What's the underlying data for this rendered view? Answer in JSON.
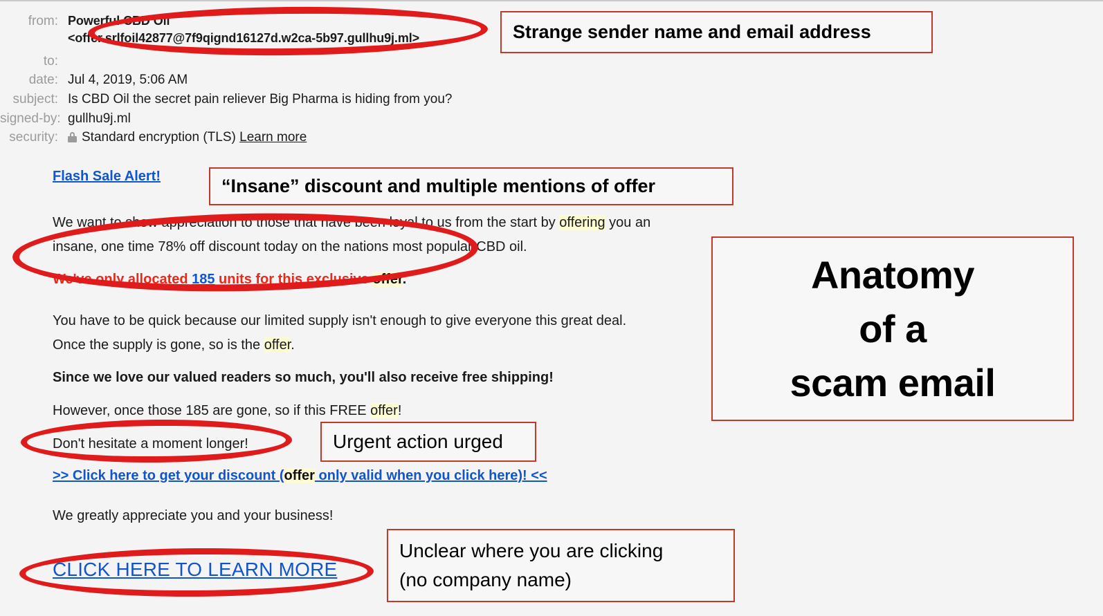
{
  "email_header": {
    "rows": [
      {
        "label": "from:",
        "value_name": "Powerful CBD Oil",
        "value_address": "<offer.srlfoil42877@7f9qignd16127d.w2ca-5b97.gullhu9j.ml>"
      },
      {
        "label": "to:",
        "value": ""
      },
      {
        "label": "date:",
        "value": "Jul 4, 2019, 5:06 AM"
      },
      {
        "label": "subject:",
        "value": "Is CBD Oil the secret pain reliever Big Pharma is hiding from you?"
      },
      {
        "label": "signed-by:",
        "value": "gullhu9j.ml"
      },
      {
        "label": "security:",
        "value": "Standard encryption (TLS)",
        "link": "Learn more",
        "icon": "lock-icon"
      }
    ]
  },
  "email_body": {
    "flash_sale_link": "Flash Sale Alert!",
    "para1_a": "We want to show appreciation to those that have been loyal to us from the start by ",
    "para1_hl": "offering",
    "para1_b": " you an",
    "para1_line2": "insane, one time 78% off discount today on the nations most popular CBD oil.",
    "allocated_a": "We've only allocated ",
    "allocated_count": "185",
    "allocated_b": " units for this exclusive ",
    "allocated_hl": "offer",
    "allocated_c": ".",
    "para2_line1": "You have to be quick because our limited supply isn't enough to give everyone this great deal.",
    "para2_line2_a": "Once the supply is gone, so is the ",
    "para2_line2_hl": "offer",
    "para2_line2_b": ".",
    "shipping_line": "Since we love our valued readers so much, you'll also receive free shipping!",
    "however_a": "However, once those 185 are gone, so if this FREE ",
    "however_hl": "offer",
    "however_b": "!",
    "hesitate_line": "Don't hesitate a moment longer!",
    "discount_link_a": ">> Click here to get your discount (",
    "discount_link_hl": "offer",
    "discount_link_b": " only valid when you click here)! <<",
    "appreciate_line": "We greatly appreciate you and your business!",
    "cta_link": "CLICK HERE TO LEARN MORE"
  },
  "annotations": {
    "sender": "Strange sender name and email address",
    "discount": "“Insane” discount and multiple mentions of offer",
    "urgent": "Urgent action urged",
    "unclear_line1": "Unclear where you are clicking",
    "unclear_line2": "(no company name)",
    "title_line1": "Anatomy",
    "title_line2": "of a",
    "title_line3": "scam email"
  },
  "colors": {
    "annotation_border": "#c0392b",
    "ellipse": "#e01b1b",
    "link": "#1155cc",
    "urgent_red": "#e8291c",
    "highlight": "#fcfbd4",
    "page_bg": "#f4f4f4"
  }
}
